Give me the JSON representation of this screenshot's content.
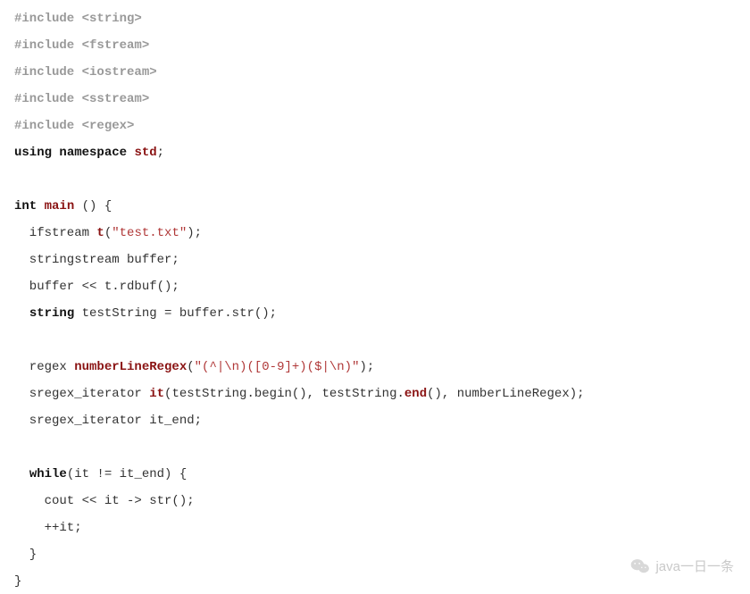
{
  "code": {
    "includes": [
      "<string>",
      "<fstream>",
      "<iostream>",
      "<sstream>",
      "<regex>"
    ],
    "using_kw": "using",
    "namespace_kw": "namespace",
    "std_name": "std",
    "semicolon": ";",
    "int_kw": "int",
    "main_fn": "main",
    "open_paren": " () {",
    "ifstream_decl_a": "  ifstream ",
    "t_name": "t",
    "test_open": "(",
    "test_str": "\"test.txt\"",
    "test_close": ");",
    "stringstream_line": "  stringstream buffer;",
    "buffer_line": "  buffer << t.rdbuf();",
    "string_kw": "string",
    "teststring_rest": " testString = buffer.str();",
    "regex_pre": "  regex ",
    "regex_name": "numberLineRegex",
    "regex_open": "(",
    "regex_str": "\"(^|\\n)([0-9]+)($|\\n)\"",
    "regex_close": ");",
    "it_pre": "  sregex_iterator ",
    "it_name": "it",
    "it_args_a": "(testString.begin(), testString.",
    "end_name": "end",
    "it_args_b": "(), numberLineRegex);",
    "itend_line": "  sregex_iterator it_end;",
    "while_kw": "while",
    "while_rest": "(it != it_end) {",
    "cout_line": "    cout << it -> str();",
    "inc_line": "    ++it;",
    "close_inner": "  }",
    "close_outer": "}",
    "two_space": "  "
  },
  "watermark": {
    "text": "java一日一条"
  }
}
